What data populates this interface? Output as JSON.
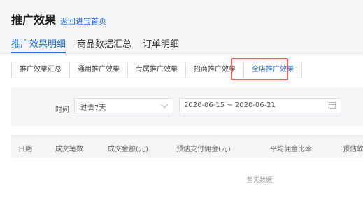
{
  "header": {
    "title": "推广效果",
    "back_link": "返回进宝首页"
  },
  "main_tabs": [
    {
      "label": "推广效果明细",
      "active": true
    },
    {
      "label": "商品数据汇总",
      "active": false
    },
    {
      "label": "订单明细",
      "active": false
    }
  ],
  "sub_tabs": [
    {
      "label": "推广效果汇总",
      "active": false
    },
    {
      "label": "通用推广效果",
      "active": false
    },
    {
      "label": "专属推广效果",
      "active": false
    },
    {
      "label": "招商推广效果",
      "active": false
    },
    {
      "label": "全店推广效果",
      "active": true
    }
  ],
  "filter": {
    "time_label": "时间",
    "period_value": "过去7天",
    "date_range": "2020-06-15 ~ 2020-06-21"
  },
  "table": {
    "columns": [
      "日期",
      "成交笔数",
      "成交金额(元)",
      "预估支付佣金(元)",
      "平均佣金比率",
      "预估软"
    ],
    "empty_text": "暂无数据"
  },
  "colors": {
    "accent": "#1f6fe0",
    "highlight_border": "#ef5d55"
  },
  "icons": {
    "select_arrow": "chevron-down-icon",
    "date_picker": "calendar-icon"
  }
}
